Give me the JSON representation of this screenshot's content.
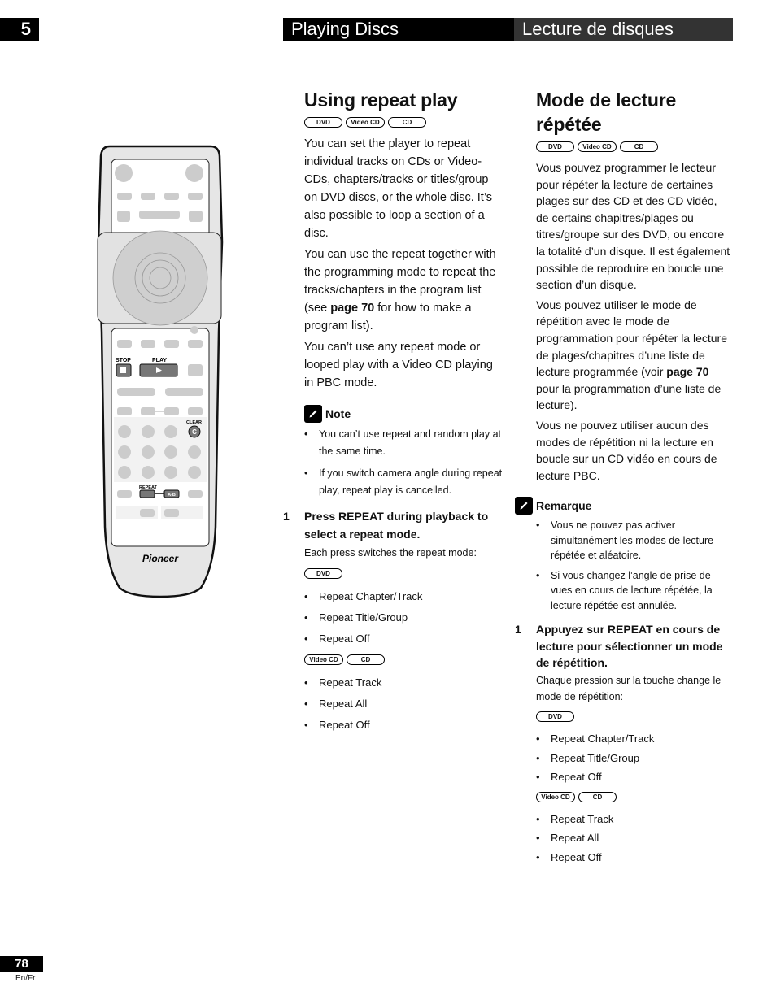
{
  "header": {
    "chapter_number": "5",
    "title_en": "Playing Discs",
    "title_fr": "Lecture de disques"
  },
  "english": {
    "title": "Using repeat play",
    "badges": [
      "DVD",
      "Video CD",
      "CD"
    ],
    "paragraph1": "You can set the player to repeat individual tracks on CDs or Video-CDs, chapters/tracks or titles/group on DVD discs, or the whole disc. It’s also possible to loop a section of a disc.",
    "paragraph2_before": "You can use the repeat together with the programming mode to repeat the tracks/chapters in the program list (see ",
    "paragraph2_bold": "page 70",
    "paragraph2_after": " for how to make a program list).",
    "paragraph3": "You can’t use any repeat mode or looped play with a Video CD playing in PBC mode.",
    "note_label": "Note",
    "notes": [
      "You can’t use repeat and random play at the same time.",
      "If you switch camera angle during repeat play, repeat play is cancelled."
    ],
    "step_number": "1",
    "step_title": "Press REPEAT during playback to select a repeat mode.",
    "step_desc": "Each press switches the repeat mode:",
    "dvd_badges": [
      "DVD"
    ],
    "dvd_modes": [
      "Repeat Chapter/Track",
      "Repeat Title/Group",
      "Repeat Off"
    ],
    "cd_badges": [
      "Video CD",
      "CD"
    ],
    "cd_modes": [
      "Repeat Track",
      "Repeat All",
      "Repeat Off"
    ]
  },
  "french": {
    "title": "Mode de lecture répétée",
    "badges": [
      "DVD",
      "Video CD",
      "CD"
    ],
    "paragraph1": "Vous pouvez programmer le lecteur pour répéter la lecture de certaines plages sur des CD et des CD vidéo, de certains chapitres/plages ou titres/groupe sur des DVD, ou encore la totalité d’un disque. Il est également possible de reproduire en boucle une section d’un disque.",
    "paragraph2_before": "Vous pouvez utiliser le mode de répétition avec le mode de programmation pour répéter la lecture de plages/chapitres d’une liste de lecture programmée (voir ",
    "paragraph2_bold": "page 70",
    "paragraph2_after": " pour la programmation d’une liste de lecture).",
    "paragraph3": "Vous ne pouvez utiliser aucun des modes de répétition ni la lecture en boucle sur un CD vidéo en cours de lecture PBC.",
    "note_label": "Remarque",
    "notes": [
      "Vous ne pouvez pas activer simultanément les modes de lecture répétée et aléatoire.",
      "Si vous changez l’angle de prise de vues en cours de lecture répétée, la lecture répétée est annulée."
    ],
    "step_number": "1",
    "step_title": "Appuyez sur REPEAT en cours de lecture pour sélectionner un mode de répétition.",
    "step_desc": "Chaque pression sur la touche change le mode de répétition:",
    "dvd_badges": [
      "DVD"
    ],
    "dvd_modes": [
      "Repeat Chapter/Track",
      "Repeat Title/Group",
      "Repeat Off"
    ],
    "cd_badges": [
      "Video CD",
      "CD"
    ],
    "cd_modes": [
      "Repeat Track",
      "Repeat All",
      "Repeat Off"
    ]
  },
  "remote": {
    "labels": {
      "stop": "STOP",
      "play": "PLAY",
      "clear": "CLEAR",
      "clear_key": "C",
      "repeat": "REPEAT",
      "ab": "A-B",
      "brand": "Pioneer"
    },
    "highlight_color": "#777777",
    "button_color": "#d0d0d0"
  },
  "footer": {
    "page_number": "78",
    "language": "En/Fr"
  }
}
